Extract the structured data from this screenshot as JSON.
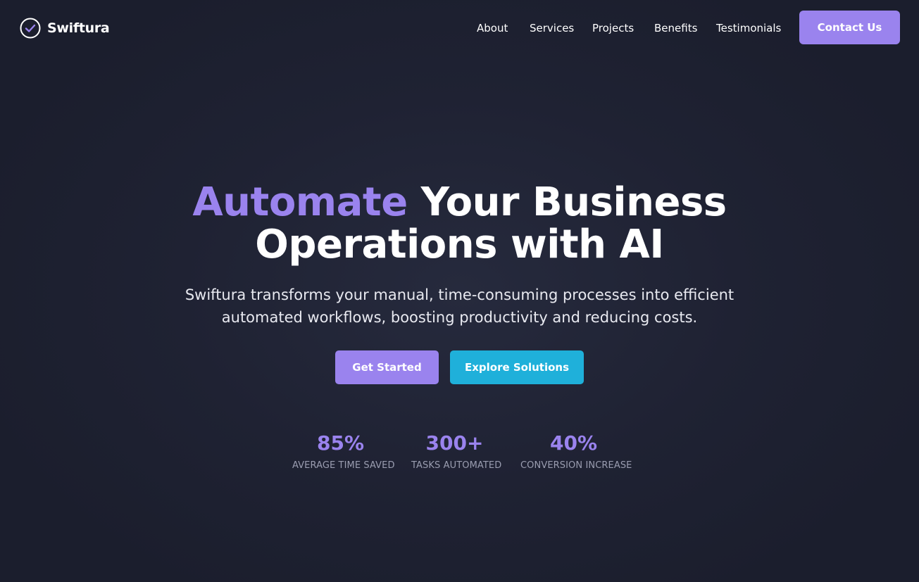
{
  "brand": {
    "name": "Swiftura",
    "icon": "check-circle-icon",
    "accent_color": "#9a83ee"
  },
  "nav": {
    "links": [
      "About",
      "Services",
      "Projects",
      "Benefits",
      "Testimonials"
    ],
    "contact_label": "Contact Us"
  },
  "hero": {
    "title_accent": "Automate",
    "title_line1_rest": " Your Business",
    "title_line2": "Operations with AI",
    "subtitle_line1": "Swiftura transforms your manual, time-consuming processes into efficient",
    "subtitle_line2": "automated workflows, boosting productivity and reducing costs.",
    "primary_cta": "Get Started",
    "secondary_cta": "Explore Solutions",
    "secondary_color": "#1fb0da"
  },
  "stats": [
    {
      "value": "85%",
      "label": "AVERAGE TIME SAVED"
    },
    {
      "value": "300+",
      "label": "TASKS AUTOMATED"
    },
    {
      "value": "40%",
      "label": "CONVERSION INCREASE"
    }
  ]
}
